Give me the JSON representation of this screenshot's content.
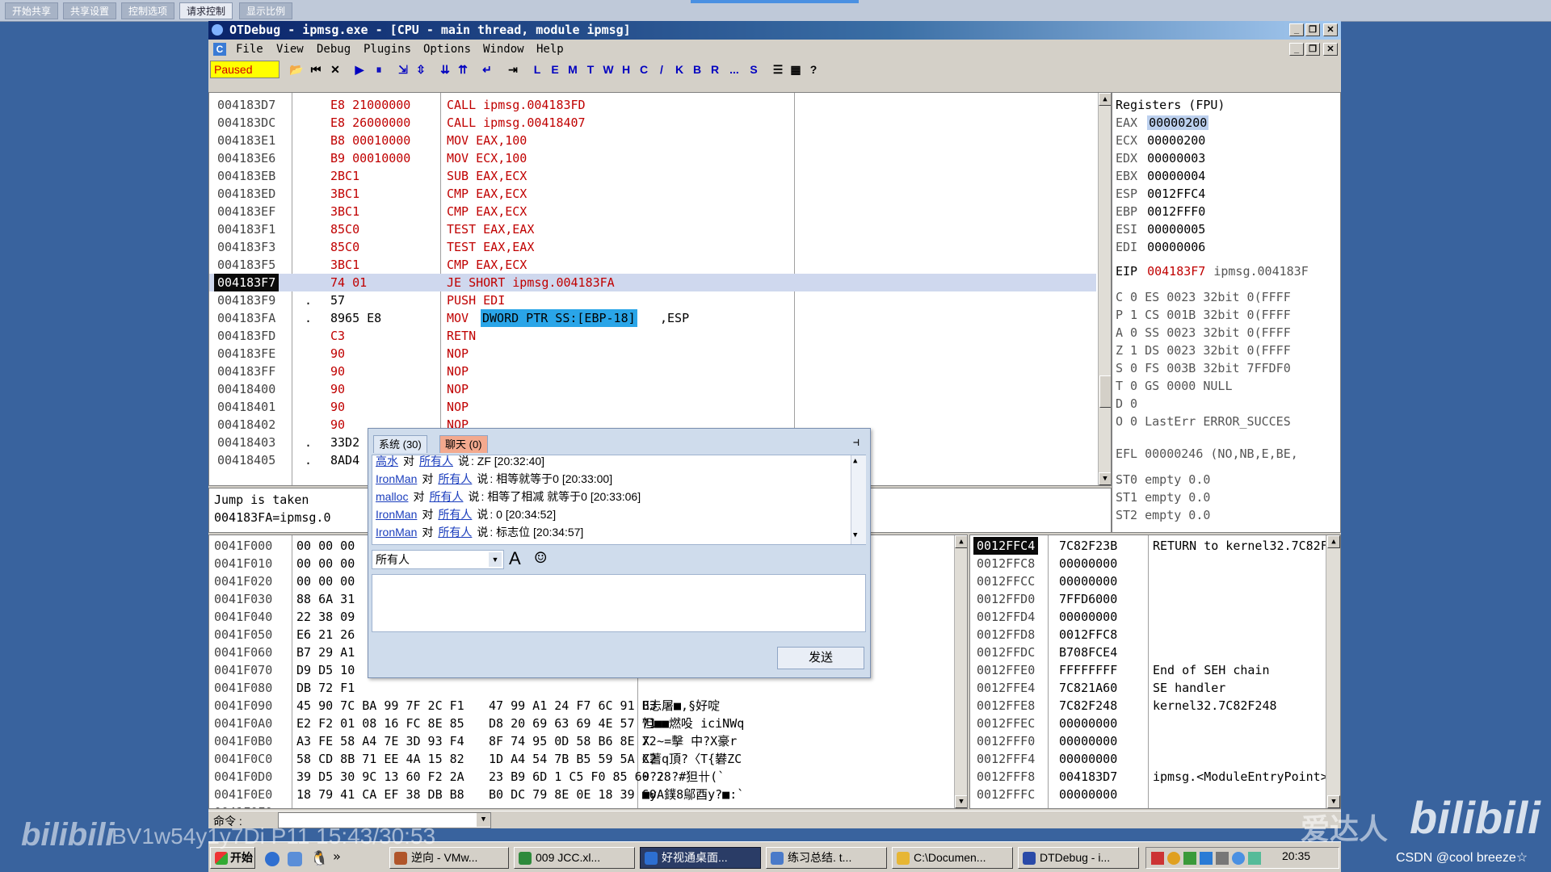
{
  "host_toolbar": {
    "buttons": [
      "开始共享",
      "共享设置",
      "控制选项",
      "请求控制",
      "显示比例"
    ]
  },
  "window": {
    "title": "OTDebug - ipmsg.exe - [CPU - main thread, module ipmsg]"
  },
  "menu": [
    "File",
    "View",
    "Debug",
    "Plugins",
    "Options",
    "Window",
    "Help"
  ],
  "menu_icon": "C",
  "toolbar": {
    "status": "Paused",
    "letters": [
      "L",
      "E",
      "M",
      "T",
      "W",
      "H",
      "C",
      "/",
      "K",
      "B",
      "R",
      "...",
      "S"
    ],
    "help": "?"
  },
  "disasm": [
    {
      "addr": "004183D7",
      "hex": "E8 21000000",
      "asm": "CALL ipmsg.004183FD"
    },
    {
      "addr": "004183DC",
      "hex": "E8 26000000",
      "asm": "CALL ipmsg.00418407"
    },
    {
      "addr": "004183E1",
      "hex": "B8 00010000",
      "asm": "MOV EAX,100"
    },
    {
      "addr": "004183E6",
      "hex": "B9 00010000",
      "asm": "MOV ECX,100"
    },
    {
      "addr": "004183EB",
      "hex": "2BC1",
      "asm": "SUB EAX,ECX"
    },
    {
      "addr": "004183ED",
      "hex": "3BC1",
      "asm": "CMP EAX,ECX"
    },
    {
      "addr": "004183EF",
      "hex": "3BC1",
      "asm": "CMP EAX,ECX"
    },
    {
      "addr": "004183F1",
      "hex": "85C0",
      "asm": "TEST EAX,EAX"
    },
    {
      "addr": "004183F3",
      "hex": "85C0",
      "asm": "TEST EAX,EAX"
    },
    {
      "addr": "004183F5",
      "hex": "3BC1",
      "asm": "CMP EAX,ECX"
    },
    {
      "addr": "004183F7",
      "hex": "74 01",
      "asm": "JE SHORT ipmsg.004183FA"
    },
    {
      "addr": "004183F9",
      "mark": ".",
      "hex": "57",
      "asm": "PUSH EDI"
    },
    {
      "addr": "004183FA",
      "mark": ".",
      "hex": "8965 E8",
      "asm": "MOV",
      "asm_hl": "DWORD PTR SS:[EBP-18]",
      "asm_tail": ",ESP"
    },
    {
      "addr": "004183FD",
      "hex": "C3",
      "asm": "RETN"
    },
    {
      "addr": "004183FE",
      "hex": "90",
      "asm": "NOP"
    },
    {
      "addr": "004183FF",
      "hex": "90",
      "asm": "NOP"
    },
    {
      "addr": "00418400",
      "hex": "90",
      "asm": "NOP"
    },
    {
      "addr": "00418401",
      "hex": "90",
      "asm": "NOP"
    },
    {
      "addr": "00418402",
      "hex": "90",
      "asm": "NOP"
    },
    {
      "addr": "00418403",
      "mark": ".",
      "hex": "33D2",
      "asm": ""
    },
    {
      "addr": "00418405",
      "mark": ".",
      "hex": "8AD4",
      "asm": ""
    }
  ],
  "info": {
    "line1": "Jump is taken",
    "line2": "004183FA=ipmsg.0"
  },
  "registers": {
    "title": "Registers (FPU)",
    "regs": [
      [
        "EAX",
        "00000200"
      ],
      [
        "ECX",
        "00000200"
      ],
      [
        "EDX",
        "00000003"
      ],
      [
        "EBX",
        "00000004"
      ],
      [
        "ESP",
        "0012FFC4"
      ],
      [
        "EBP",
        "0012FFF0"
      ],
      [
        "ESI",
        "00000005"
      ],
      [
        "EDI",
        "00000006"
      ]
    ],
    "eip": {
      "name": "EIP",
      "val": "004183F7",
      "desc": "ipmsg.004183F"
    },
    "flags": [
      "C 0  ES 0023 32bit 0(FFFF",
      "P 1  CS 001B 32bit 0(FFFF",
      "A 0  SS 0023 32bit 0(FFFF",
      "Z 1  DS 0023 32bit 0(FFFF",
      "S 0  FS 003B 32bit 7FFDF0",
      "T 0  GS 0000 NULL",
      "D 0",
      "O 0  LastErr ERROR_SUCCES"
    ],
    "efl": "EFL 00000246 (NO,NB,E,BE,",
    "st": [
      "ST0 empty 0.0",
      "ST1 empty 0.0",
      "ST2 empty 0.0"
    ]
  },
  "dump": [
    {
      "addr": "0041F000",
      "hex": "00 00 00",
      "hex2": "",
      "ascii": ""
    },
    {
      "addr": "0041F010",
      "hex": "00 00 00",
      "hex2": "",
      "ascii": ""
    },
    {
      "addr": "0041F020",
      "hex": "00 00 00",
      "hex2": "",
      "ascii": ""
    },
    {
      "addr": "0041F030",
      "hex": "88 6A 31",
      "hex2": "",
      "ascii": ""
    },
    {
      "addr": "0041F040",
      "hex": "22 38 09",
      "hex2": "",
      "ascii": ""
    },
    {
      "addr": "0041F050",
      "hex": "E6 21 26",
      "hex2": "",
      "ascii": ""
    },
    {
      "addr": "0041F060",
      "hex": "B7 29 A1",
      "hex2": "",
      "ascii": ""
    },
    {
      "addr": "0041F070",
      "hex": "D9 D5 10",
      "hex2": "",
      "ascii": ""
    },
    {
      "addr": "0041F080",
      "hex": "DB 72 F1",
      "hex2": "",
      "ascii": ""
    },
    {
      "addr": "0041F090",
      "hex": "45 90 7C BA 99 7F 2C F1",
      "hex2": "47 99 A1 24 F7 6C 91 B3",
      "ascii": "E忐屠■,§好啶"
    },
    {
      "addr": "0041F0A0",
      "hex": "E2 F2 01 08 16 FC 8E 85",
      "hex2": "D8 20 69 63 69 4E 57 71",
      "ascii": "怛■■燃吺 iciNWq"
    },
    {
      "addr": "0041F0B0",
      "hex": "A3 FE 58 A4 7E 3D 93 F4",
      "hex2": "8F 74 95 0D 58 B6 8E 72",
      "ascii": "X  ~=擊 中?X豪r"
    },
    {
      "addr": "0041F0C0",
      "hex": "58 CD 8B 71 EE 4A 15 82",
      "hex2": "1D A4 54 7B B5 59 5A C2",
      "ascii": "X蓍q頂?〈T{礬ZC"
    },
    {
      "addr": "0041F0D0",
      "hex": "39 D5 30 9C 13 60 F2 2A",
      "hex2": "23 B9 6D 1 C5 F0 85 60 28",
      "ascii": "9?? ?#狚卄(`"
    },
    {
      "addr": "0041F0E0",
      "hex": "18 79 41 CA EF 38 DB B8",
      "hex2": "B0 DC 79 8E 0E 18 39 60",
      "ascii": "■yA鏷8鄔酉y?■:`"
    },
    {
      "addr": "0041F0F0",
      "hex": "",
      "hex2": "",
      "ascii": ""
    }
  ],
  "stack": [
    {
      "addr": "0012FFC4",
      "val": "7C82F23B",
      "cmt": "RETURN to kernel32.7C82F"
    },
    {
      "addr": "0012FFC8",
      "val": "00000000",
      "cmt": ""
    },
    {
      "addr": "0012FFCC",
      "val": "00000000",
      "cmt": ""
    },
    {
      "addr": "0012FFD0",
      "val": "7FFD6000",
      "cmt": ""
    },
    {
      "addr": "0012FFD4",
      "val": "00000000",
      "cmt": ""
    },
    {
      "addr": "0012FFD8",
      "val": "0012FFC8",
      "cmt": ""
    },
    {
      "addr": "0012FFDC",
      "val": "B708FCE4",
      "cmt": ""
    },
    {
      "addr": "0012FFE0",
      "val": "FFFFFFFF",
      "cmt": "End of SEH chain"
    },
    {
      "addr": "0012FFE4",
      "val": "7C821A60",
      "cmt": "SE handler"
    },
    {
      "addr": "0012FFE8",
      "val": "7C82F248",
      "cmt": "kernel32.7C82F248"
    },
    {
      "addr": "0012FFEC",
      "val": "00000000",
      "cmt": ""
    },
    {
      "addr": "0012FFF0",
      "val": "00000000",
      "cmt": ""
    },
    {
      "addr": "0012FFF4",
      "val": "00000000",
      "cmt": ""
    },
    {
      "addr": "0012FFF8",
      "val": "004183D7",
      "cmt": "ipmsg.<ModuleEntryPoint>"
    },
    {
      "addr": "0012FFFC",
      "val": "00000000",
      "cmt": ""
    }
  ],
  "command": {
    "label": "命令 :"
  },
  "chat": {
    "tabs": [
      "系统 (30)",
      "聊天 (0)"
    ],
    "messages": [
      {
        "from": "高水",
        "to_word": "对",
        "to": "所有人",
        "say": "说",
        "text": ": ZF [20:32:40]"
      },
      {
        "from": "IronMan",
        "to_word": "对",
        "to": "所有人",
        "say": "说",
        "text": ": 相等就等于0 [20:33:00]"
      },
      {
        "from": "malloc",
        "to_word": "对",
        "to": "所有人",
        "say": "说",
        "text": ": 相等了相减 就等于0 [20:33:06]"
      },
      {
        "from": "IronMan",
        "to_word": "对",
        "to": "所有人",
        "say": "说",
        "text": ": 0 [20:34:52]"
      },
      {
        "from": "IronMan",
        "to_word": "对",
        "to": "所有人",
        "say": "说",
        "text": ": 标志位 [20:34:57]"
      }
    ],
    "recipient": "所有人",
    "font_btn": "A",
    "send": "发送"
  },
  "taskbar": {
    "start": "开始",
    "items": [
      {
        "label": "逆向 - VMw...",
        "color": "#b0552a"
      },
      {
        "label": "009 JCC.xl...",
        "color": "#2e8a3c"
      },
      {
        "label": "好视通桌面...",
        "color": "#2d6fd1"
      },
      {
        "label": "练习总结. t...",
        "color": "#4a7ac9"
      },
      {
        "label": "C:\\Documen...",
        "color": "#e7b634"
      },
      {
        "label": "DTDebug - i...",
        "color": "#2a4aa8"
      }
    ],
    "clock": "20:35"
  },
  "watermarks": {
    "bv": "BV1w54y1y7Di P11 15:43/30:53",
    "ai": "爱达人",
    "bili": "bilibili",
    "csdn": "CSDN @cool breeze☆"
  }
}
